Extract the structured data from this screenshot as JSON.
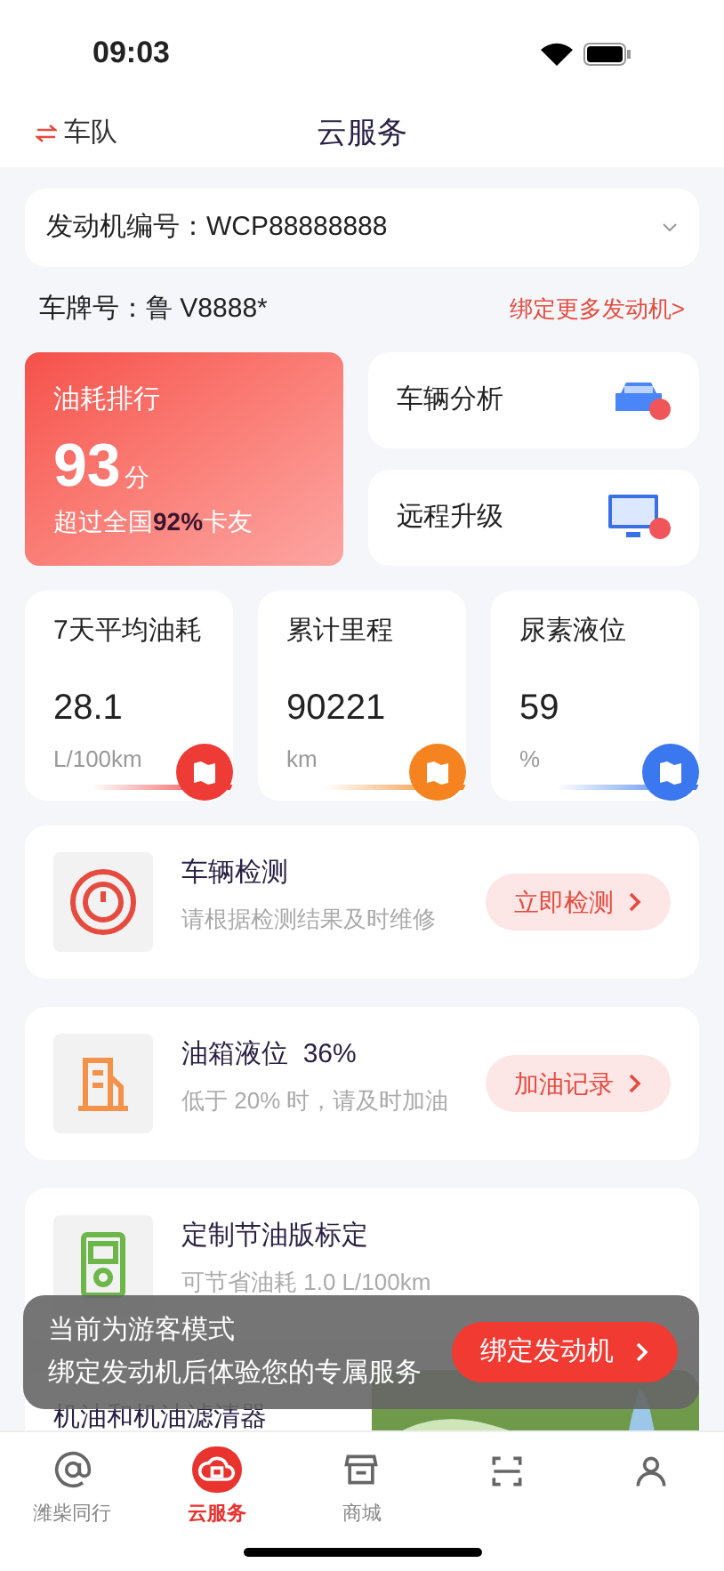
{
  "status_bar": {
    "time": "09:03"
  },
  "header": {
    "left_label": "车队",
    "title": "云服务"
  },
  "engine_select": {
    "label": "发动机编号：",
    "value": "WCP88888888"
  },
  "plate": {
    "label": "车牌号：",
    "value": "鲁 V8888*",
    "link": "绑定更多发动机>"
  },
  "ranking": {
    "title": "油耗排行",
    "score": "93",
    "unit": "分",
    "note": "超过全国**92%**卡友"
  },
  "shortcuts": [
    {
      "kind": "car",
      "label": "车辆分析"
    },
    {
      "kind": "monitor",
      "label": "远程升级"
    }
  ],
  "stats": [
    {
      "title": "7天平均油耗",
      "value": "28.1",
      "unit": "L/100km",
      "color": "#ef3b36"
    },
    {
      "title": "累计里程",
      "value": "90221",
      "unit": "km",
      "color": "#f5831f"
    },
    {
      "title": "尿素液位",
      "value": "59",
      "unit": "%",
      "color": "#3b78f0"
    }
  ],
  "services": [
    {
      "kind": "gauge",
      "title": "车辆检测",
      "subtitle": "请根据检测结果及时维修",
      "button": "立即检测"
    },
    {
      "kind": "fuel",
      "title": "油箱液位  36%",
      "subtitle": "低于 20% 时，请及时加油",
      "button": "加油记录"
    },
    {
      "kind": "meter",
      "title": "定制节油版标定",
      "subtitle": "可节省油耗 1.0 L/100km"
    },
    {
      "kind": "map",
      "title": "机油和机油滤清器"
    }
  ],
  "toast": {
    "line1": "当前为游客模式",
    "line2": "绑定发动机后体验您的专属服务",
    "button": "绑定发动机"
  },
  "tab_bar": [
    {
      "kind": "at",
      "label": "潍柴同行",
      "selected": false
    },
    {
      "kind": "cloud",
      "label": "云服务",
      "selected": true
    },
    {
      "kind": "store",
      "label": "商城",
      "selected": false
    },
    {
      "kind": "scan",
      "selected": false
    },
    {
      "kind": "person",
      "selected": false
    }
  ]
}
